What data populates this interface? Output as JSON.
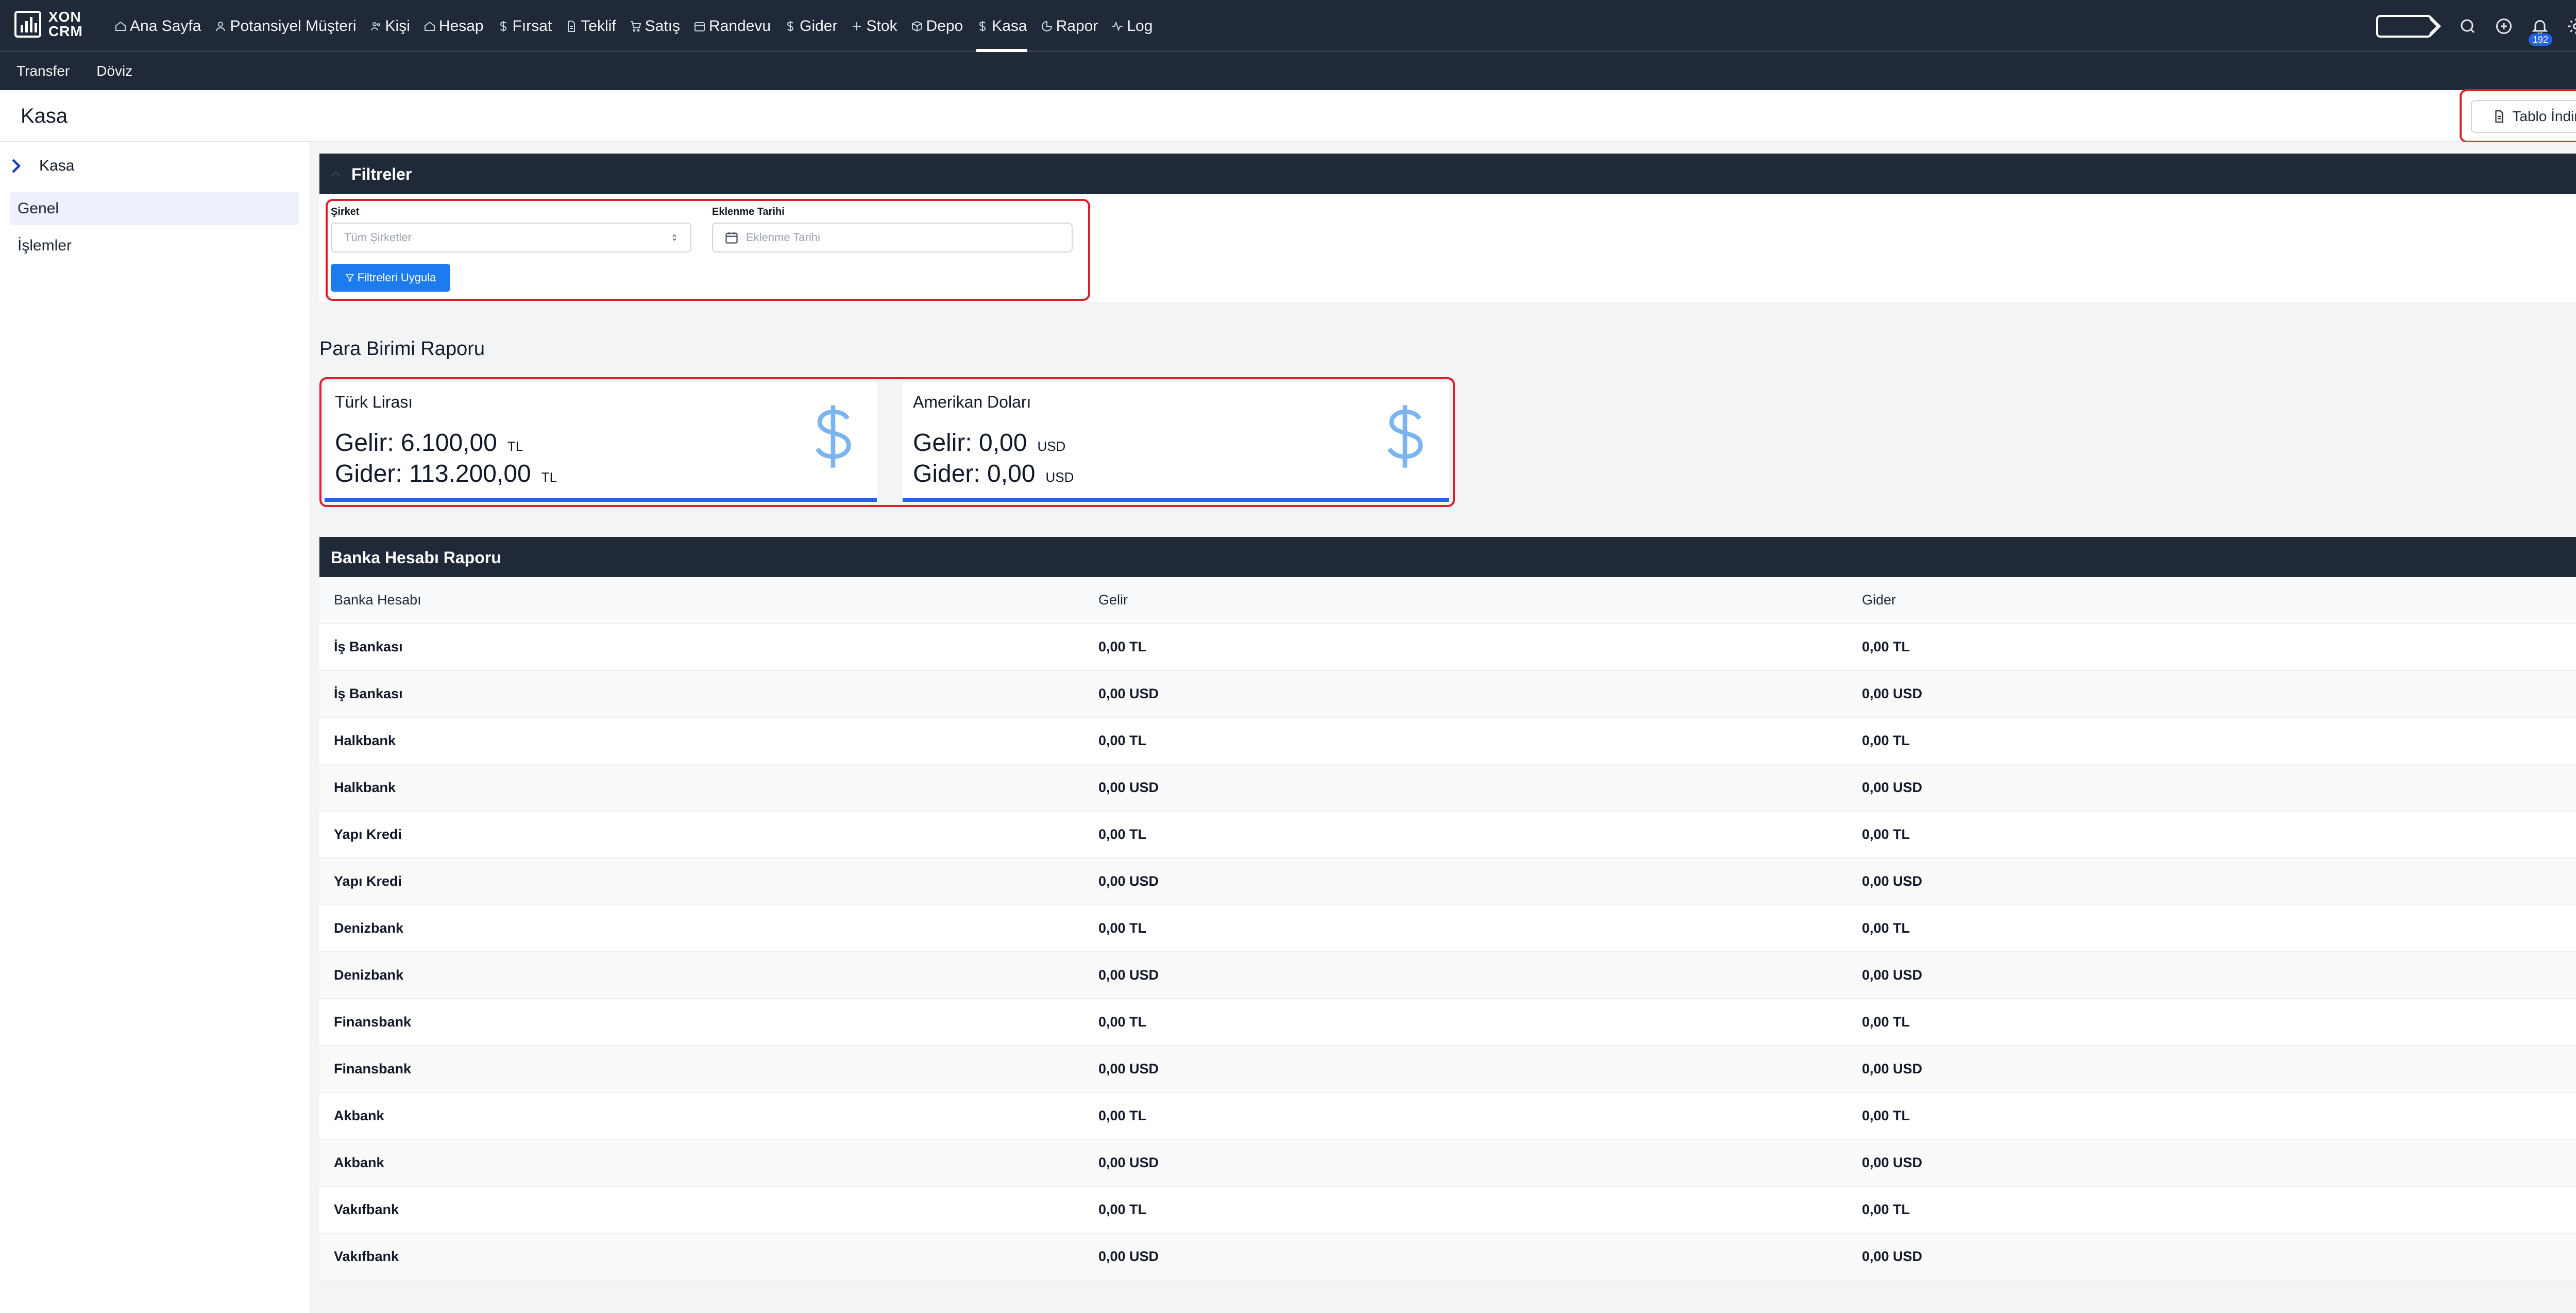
{
  "brand": {
    "line1": "XON",
    "line2": "CRM"
  },
  "nav": {
    "items": [
      {
        "label": "Ana Sayfa",
        "icon": "home-icon"
      },
      {
        "label": "Potansiyel Müşteri",
        "icon": "user-icon"
      },
      {
        "label": "Kişi",
        "icon": "users-icon"
      },
      {
        "label": "Hesap",
        "icon": "home-icon"
      },
      {
        "label": "Fırsat",
        "icon": "dollar-icon"
      },
      {
        "label": "Teklif",
        "icon": "document-icon"
      },
      {
        "label": "Satış",
        "icon": "cart-icon"
      },
      {
        "label": "Randevu",
        "icon": "calendar-icon"
      },
      {
        "label": "Gider",
        "icon": "dollar-icon"
      },
      {
        "label": "Stok",
        "icon": "plus-icon"
      },
      {
        "label": "Depo",
        "icon": "box-icon"
      },
      {
        "label": "Kasa",
        "icon": "dollar-icon",
        "active": true
      },
      {
        "label": "Rapor",
        "icon": "pie-chart-icon"
      },
      {
        "label": "Log",
        "icon": "activity-icon"
      }
    ],
    "notification_count": "192"
  },
  "subnav": {
    "items": [
      "Transfer",
      "Döviz"
    ]
  },
  "page": {
    "title": "Kasa",
    "download_label": "Tablo İndir"
  },
  "sidebar": {
    "heading": "Kasa",
    "items": [
      "Genel",
      "İşlemler"
    ],
    "active_index": 0
  },
  "filters": {
    "title": "Filtreler",
    "company_label": "Şirket",
    "company_value": "Tüm Şirketler",
    "date_label": "Eklenme Tarihi",
    "date_placeholder": "Eklenme Tarihi",
    "apply_label": "Filtreleri Uygula"
  },
  "currency_report": {
    "title": "Para Birimi Raporu",
    "cards": [
      {
        "name": "Türk Lirası",
        "income": "Gelir: 6.100,00",
        "income_unit": "TL",
        "expense": "Gider: 113.200,00",
        "expense_unit": "TL"
      },
      {
        "name": "Amerikan Doları",
        "income": "Gelir: 0,00",
        "income_unit": "USD",
        "expense": "Gider: 0,00",
        "expense_unit": "USD"
      }
    ]
  },
  "bank_report": {
    "title": "Banka Hesabı Raporu",
    "columns": [
      "Banka Hesabı",
      "Gelir",
      "Gider"
    ],
    "rows": [
      [
        "İş Bankası",
        "0,00 TL",
        "0,00 TL"
      ],
      [
        "İş Bankası",
        "0,00 USD",
        "0,00 USD"
      ],
      [
        "Halkbank",
        "0,00 TL",
        "0,00 TL"
      ],
      [
        "Halkbank",
        "0,00 USD",
        "0,00 USD"
      ],
      [
        "Yapı Kredi",
        "0,00 TL",
        "0,00 TL"
      ],
      [
        "Yapı Kredi",
        "0,00 USD",
        "0,00 USD"
      ],
      [
        "Denizbank",
        "0,00 TL",
        "0,00 TL"
      ],
      [
        "Denizbank",
        "0,00 USD",
        "0,00 USD"
      ],
      [
        "Finansbank",
        "0,00 TL",
        "0,00 TL"
      ],
      [
        "Finansbank",
        "0,00 USD",
        "0,00 USD"
      ],
      [
        "Akbank",
        "0,00 TL",
        "0,00 TL"
      ],
      [
        "Akbank",
        "0,00 USD",
        "0,00 USD"
      ],
      [
        "Vakıfbank",
        "0,00 TL",
        "0,00 TL"
      ],
      [
        "Vakıfbank",
        "0,00 USD",
        "0,00 USD"
      ]
    ]
  },
  "colors": {
    "navbar": "#1f2937",
    "accent": "#2563eb",
    "highlight": "#e11d2a",
    "apply_button": "#1d7bf0"
  }
}
